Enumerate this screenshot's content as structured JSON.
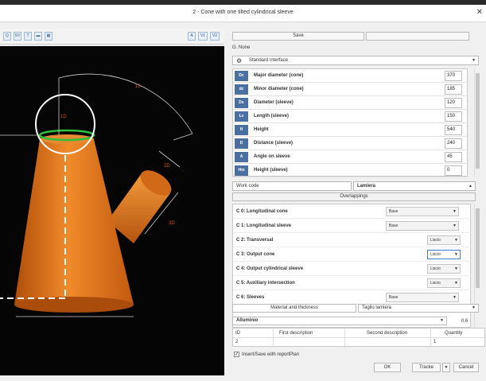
{
  "window": {
    "title": "2 - Cone with one tilted cylindrical sleeve"
  },
  "toolbar": {
    "buttons": [
      "Q",
      "SV",
      "T",
      "",
      ""
    ],
    "view_buttons": [
      "A",
      "V1",
      "V2"
    ]
  },
  "viewer": {
    "dimension_labels": [
      "10",
      "2D",
      "3D",
      "1D"
    ]
  },
  "panel": {
    "save_label": "Save",
    "node_label": "G. None",
    "interface_select": "Standard interface",
    "parameters": [
      {
        "symbol": "Dc",
        "name": "Major diameter (cone)",
        "value": "370"
      },
      {
        "symbol": "dc",
        "name": "Minor diameter (cone)",
        "value": "185"
      },
      {
        "symbol": "Dx",
        "name": "Diameter (sleeve)",
        "value": "120"
      },
      {
        "symbol": "Lx",
        "name": "Length (sleeve)",
        "value": "150"
      },
      {
        "symbol": "H",
        "name": "Height",
        "value": "540"
      },
      {
        "symbol": "D",
        "name": "Distance (sleeve)",
        "value": "240"
      },
      {
        "symbol": "A",
        "name": "Angle on sleeve",
        "value": "45"
      },
      {
        "symbol": "Hm",
        "name": "Height (sleeve)",
        "value": "0"
      }
    ],
    "work_mode_label": "Work code",
    "work_mode_value": "Lamiera",
    "overlappings_label": "Overlappings",
    "overlappings": [
      {
        "name": "C 0: Longitudinal cone",
        "value": "Base",
        "active": false
      },
      {
        "name": "C 1: Longitudinal sleeve",
        "value": "Base",
        "active": false
      },
      {
        "name": "C 2: Transversal",
        "value": "Liscio",
        "active": false
      },
      {
        "name": "C 3: Output cone",
        "value": "Liscio",
        "active": true
      },
      {
        "name": "C 4: Output cylindrical sleeve",
        "value": "Liscio",
        "active": false
      },
      {
        "name": "C 5: Auxiliary intersection",
        "value": "Liscio",
        "active": false
      },
      {
        "name": "C 6: Sleeves",
        "value": "Base",
        "active": false
      }
    ],
    "tabs": [
      "Material and thickness",
      "Taglio lamiera"
    ],
    "material": {
      "name": "Alluminio",
      "thickness": "0.6"
    },
    "grid": {
      "headers": [
        "ID",
        "First description",
        "Second description",
        "Quantity"
      ],
      "row": [
        "2",
        "",
        "",
        "1"
      ]
    },
    "insert_label": "Insert/Save with reportPlan",
    "ok_label": "OK",
    "trace_label": "Tracke",
    "cancel_label": "Cancel"
  },
  "colors": {
    "accent": "#3c7fd0",
    "cone": "#e27a1c",
    "highlight": "#2fbf3a"
  }
}
